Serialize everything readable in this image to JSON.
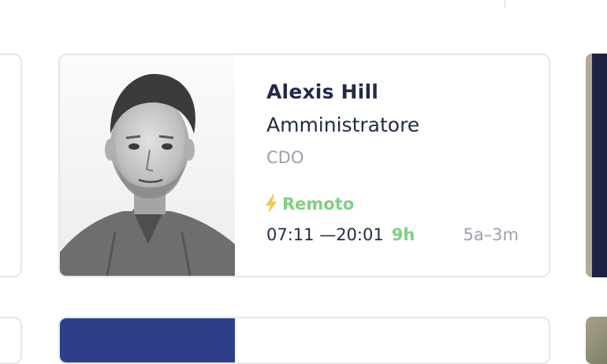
{
  "employee_card": {
    "name": "Alexis Hill",
    "role": "Amministratore",
    "department": "CDO",
    "status": {
      "label": "Remoto",
      "icon": "lightning-bolt-icon",
      "color": "#7fd181"
    },
    "schedule": {
      "time_range": "07:11 —20:01",
      "duration": "9h",
      "timezone_range": "5a–3m"
    }
  },
  "colors": {
    "text_primary": "#1f2a4a",
    "text_muted": "#9aa1ad",
    "accent_green": "#7fd181",
    "card_border": "#e5e7eb",
    "below_card_photo": "#2d3f8a"
  }
}
